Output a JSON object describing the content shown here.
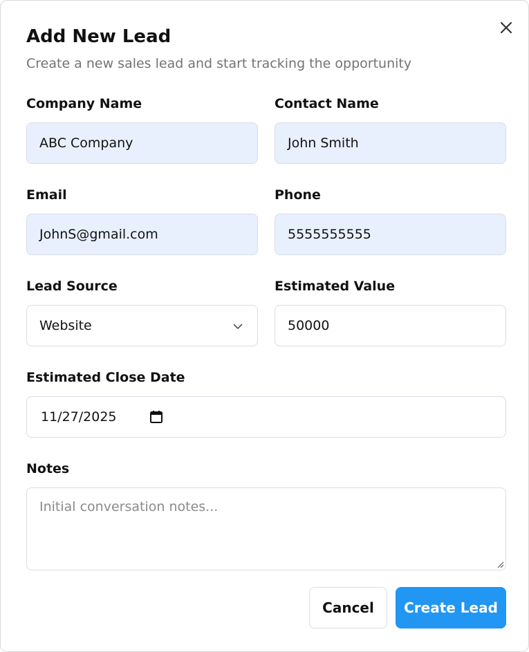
{
  "dialog": {
    "title": "Add New Lead",
    "subtitle": "Create a new sales lead and start tracking the opportunity",
    "close_icon": "close-icon"
  },
  "form": {
    "company_name": {
      "label": "Company Name",
      "value": "ABC Company"
    },
    "contact_name": {
      "label": "Contact Name",
      "value": "John Smith"
    },
    "email": {
      "label": "Email",
      "value": "JohnS@gmail.com"
    },
    "phone": {
      "label": "Phone",
      "value": "5555555555"
    },
    "lead_source": {
      "label": "Lead Source",
      "value": "Website",
      "icon": "chevron-down-icon"
    },
    "estimated_value": {
      "label": "Estimated Value",
      "value": "50000"
    },
    "estimated_close_date": {
      "label": "Estimated Close Date",
      "value": "11/27/2025",
      "icon": "calendar-icon"
    },
    "notes": {
      "label": "Notes",
      "placeholder": "Initial conversation notes..."
    }
  },
  "actions": {
    "cancel_label": "Cancel",
    "submit_label": "Create Lead"
  },
  "colors": {
    "primary": "#2196f3",
    "autofill_background": "#e8f0fe",
    "border": "#d9dde3",
    "muted_text": "#737373"
  }
}
